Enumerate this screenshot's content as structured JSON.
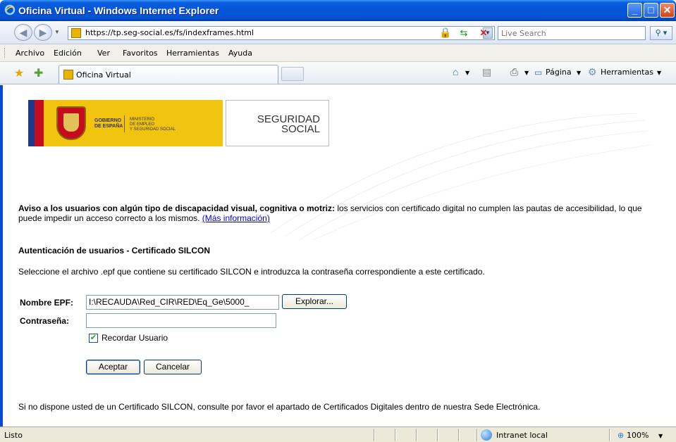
{
  "window": {
    "title": "Oficina Virtual - Windows Internet Explorer"
  },
  "address_bar": {
    "url": "https://tp.seg-social.es/fs/indexframes.html",
    "search_placeholder": "Live Search"
  },
  "menu": {
    "items": [
      "Archivo",
      "Edición",
      "Ver",
      "Favoritos",
      "Herramientas",
      "Ayuda"
    ]
  },
  "tabs": {
    "active_tab": "Oficina Virtual",
    "page_label": "Página",
    "tools_label": "Herramientas"
  },
  "banner": {
    "gobierno": "GOBIERNO\nDE ESPAÑA",
    "ministerio": "MINISTERIO\nDE EMPLEO\nY SEGURIDAD SOCIAL",
    "seguridad_line1": "SEGURIDAD",
    "seguridad_line2": "SOCIAL"
  },
  "page": {
    "notice_bold": "Aviso a los usuarios con algún tipo de discapacidad visual, cognitiva o motriz:",
    "notice_text": " los servicios con certificado digital no cumplen las pautas de accesibilidad, lo que puede impedir un acceso correcto a los mismos. ",
    "notice_link": "(Más información)",
    "auth_heading": "Autenticación de usuarios - Certificado SILCON",
    "instructions": "Seleccione el archivo .epf que contiene su certificado SILCON e introduzca la contraseña correspondiente a este certificado.",
    "epf_label": "Nombre EPF:",
    "epf_value": "I:\\RECAUDA\\Red_CIR\\RED\\Eq_Ge\\5000_",
    "browse_button": "Explorar...",
    "password_label": "Contraseña:",
    "password_value": "",
    "remember_label": "Recordar Usuario",
    "remember_checked": true,
    "accept_button": "Aceptar",
    "cancel_button": "Cancelar",
    "footer_text": "Si no dispone usted de un Certificado SILCON, consulte por favor el apartado de Certificados Digitales dentro de nuestra Sede Electrónica."
  },
  "statusbar": {
    "status": "Listo",
    "zone": "Intranet local",
    "zoom": "100%"
  },
  "colors": {
    "titlebar": "#0554d8",
    "banner_yellow": "#f1c40f",
    "link": "#0000cc"
  }
}
